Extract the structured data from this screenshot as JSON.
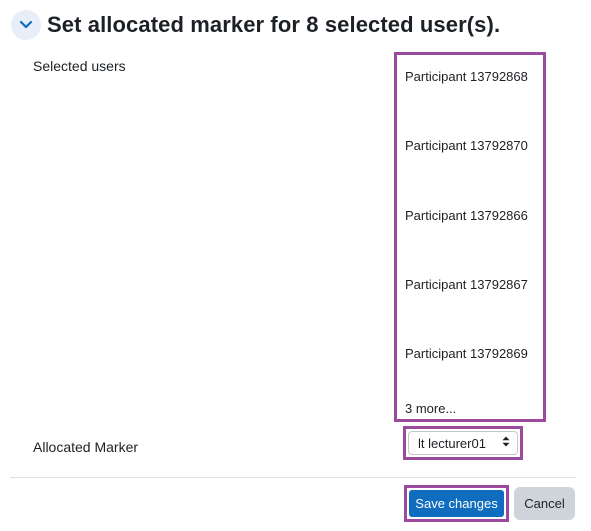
{
  "header": {
    "collapse_icon": "chevron-down-icon",
    "title": "Set allocated marker for 8 selected user(s)."
  },
  "form": {
    "selected_users_label": "Selected users",
    "selected_users": [
      "Participant 13792868",
      "Participant 13792870",
      "Participant 13792866",
      "Participant 13792867",
      "Participant 13792869"
    ],
    "more_text": "3 more...",
    "allocated_marker_label": "Allocated Marker",
    "allocated_marker_value": "lt lecturer01"
  },
  "actions": {
    "save_label": "Save changes",
    "cancel_label": "Cancel"
  },
  "colors": {
    "accent": "#0f6cbf",
    "highlight_outline": "#9c4a9e",
    "cancel_bg": "#ced4da"
  }
}
